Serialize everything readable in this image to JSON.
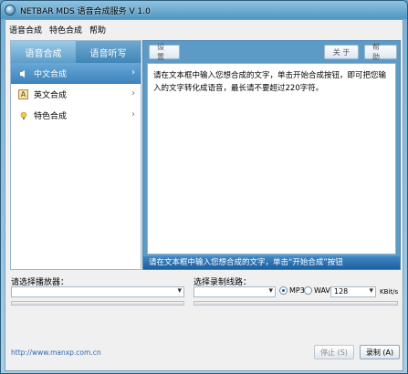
{
  "window": {
    "title": "NETBAR MDS 语音合成服务 V 1.0"
  },
  "menu": [
    "语音合成",
    "特色合成",
    "帮助"
  ],
  "sidebar": {
    "tabs": [
      {
        "label": "语音合成"
      },
      {
        "label": "语音听写"
      }
    ],
    "items": [
      {
        "label": "中文合成",
        "icon": "speaker-icon"
      },
      {
        "label": "英文合成",
        "icon": "letter-a-icon"
      },
      {
        "label": "特色合成",
        "icon": "bulb-icon"
      }
    ]
  },
  "toolbar": {
    "settings_label": "设 置",
    "about_label": "关 于",
    "help_label": "帮 助"
  },
  "editor": {
    "text": "请在文本框中输入您想合成的文字，单击开始合成按钮，即可把您输入的文字转化成语音，最长请不要超过220字符。"
  },
  "hint": {
    "text": "请在文本框中输入您想合成的文字，单击“开始合成”按钮"
  },
  "bottom": {
    "player_label": "请选择播放器：",
    "record_line_label": "选择录制线路：",
    "format_options": [
      "MP3",
      "WAV"
    ],
    "selected_format": "MP3",
    "bitrate_value": "128",
    "bitrate_unit": "KBit/s",
    "url": "http://www.manxp.com.cn",
    "stop_label": "停止 (S)",
    "record_label": "录制 (A)"
  }
}
